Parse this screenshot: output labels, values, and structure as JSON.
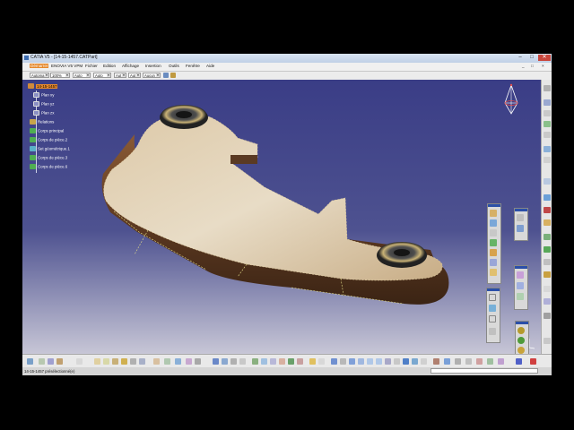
{
  "window": {
    "title": "CATIA V5 - [14-15-1457.CATPart]",
    "controls": [
      "–",
      "□",
      "✕"
    ]
  },
  "menu": {
    "items": [
      "Démarrer",
      "ENOVIA V5 VPM",
      "Fichier",
      "Edition",
      "Affichage",
      "Insertion",
      "Outils",
      "Fenêtre",
      "Aide"
    ],
    "active": "Démarrer",
    "right_controls": [
      "_",
      "□",
      "×"
    ]
  },
  "toolbar": {
    "combos": [
      {
        "name": "color",
        "value": "Automa"
      },
      {
        "name": "transparency",
        "value": "100%"
      },
      {
        "name": "linetype",
        "value": "Auto"
      },
      {
        "name": "thickness",
        "value": "Auto"
      },
      {
        "name": "point",
        "value": "Aut"
      },
      {
        "name": "layer",
        "value": "Aut"
      },
      {
        "name": "filter",
        "value": "Aucun"
      }
    ]
  },
  "tree": {
    "items": [
      {
        "label": "14-15-1457",
        "icon": "part-icon",
        "selected": true
      },
      {
        "label": "Plan xy",
        "icon": "plane-icon",
        "selected": false
      },
      {
        "label": "Plan yz",
        "icon": "plane-icon",
        "selected": false
      },
      {
        "label": "Plan zx",
        "icon": "plane-icon",
        "selected": false
      },
      {
        "label": "Relations",
        "icon": "relations-icon",
        "selected": false
      },
      {
        "label": "Corps principal",
        "icon": "body-icon",
        "selected": false
      },
      {
        "label": "Corps de pièce.2",
        "icon": "body-icon",
        "selected": false
      },
      {
        "label": "Set géométrique.1",
        "icon": "geoset-icon",
        "selected": false
      },
      {
        "label": "Corps de pièce.3",
        "icon": "body-icon",
        "selected": false
      },
      {
        "label": "Corps de pièce.6",
        "icon": "body-icon",
        "selected": false
      }
    ]
  },
  "status": {
    "text": "14-15-1457 présélectionné(e)"
  },
  "colors": {
    "wood": "#c9b08a",
    "wood_side": "#6d4428",
    "highlight": "#e6892c",
    "background_top": "#3a3d86"
  }
}
